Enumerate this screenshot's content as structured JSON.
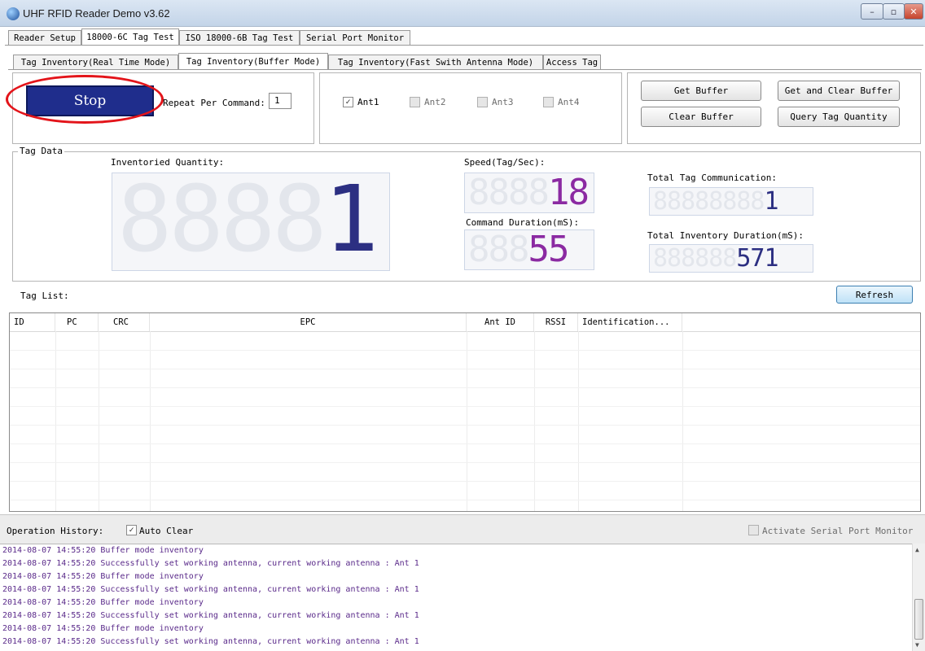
{
  "window": {
    "title": "UHF RFID Reader Demo v3.62",
    "minimize": "–",
    "maximize": "▫",
    "close": "✕"
  },
  "main_tabs": [
    "Reader Setup",
    "18000-6C Tag Test",
    "ISO 18000-6B Tag Test",
    "Serial Port Monitor"
  ],
  "sub_tabs": [
    "Tag Inventory(Real Time Mode)",
    "Tag Inventory(Buffer Mode)",
    "Tag Inventory(Fast Swith Antenna Mode)",
    "Access Tag"
  ],
  "controls": {
    "stop_label": "Stop",
    "repeat_label": "Repeat Per Command:",
    "repeat_value": "1",
    "antennas": [
      {
        "label": "Ant1",
        "checked": true
      },
      {
        "label": "Ant2",
        "checked": false
      },
      {
        "label": "Ant3",
        "checked": false
      },
      {
        "label": "Ant4",
        "checked": false
      }
    ],
    "get_buffer": "Get Buffer",
    "get_clear_buffer": "Get and Clear Buffer",
    "clear_buffer": "Clear Buffer",
    "query_tag_quantity": "Query Tag Quantity"
  },
  "tag_data": {
    "group_label": "Tag Data",
    "inventoried_label": "Inventoried Quantity:",
    "inventoried_value": "1",
    "speed_label": "Speed(Tag/Sec):",
    "speed_value": "18",
    "command_duration_label": "Command Duration(mS):",
    "command_duration_value": "55",
    "total_comm_label": "Total Tag Communication:",
    "total_comm_value": "1",
    "total_duration_label": "Total Inventory Duration(mS):",
    "total_duration_value": "571"
  },
  "tag_list": {
    "label": "Tag List:",
    "refresh": "Refresh",
    "columns": [
      "ID",
      "PC",
      "CRC",
      "EPC",
      "Ant ID",
      "RSSI",
      "Identification..."
    ]
  },
  "history": {
    "label": "Operation History:",
    "auto_clear": "Auto Clear",
    "activate_monitor": "Activate Serial Port Monitor",
    "lines": [
      "2014-08-07 14:55:20 Buffer mode inventory",
      "2014-08-07 14:55:20 Successfully set working antenna, current working antenna : Ant 1",
      "2014-08-07 14:55:20 Buffer mode inventory",
      "2014-08-07 14:55:20 Successfully set working antenna, current working antenna : Ant 1",
      "2014-08-07 14:55:20 Buffer mode inventory",
      "2014-08-07 14:55:20 Successfully set working antenna, current working antenna : Ant 1",
      "2014-08-07 14:55:20 Buffer mode inventory",
      "2014-08-07 14:55:20 Successfully set working antenna, current working antenna : Ant 1"
    ]
  },
  "colors": {
    "stop_button": "#1f2d8c",
    "highlight_ellipse": "#e3141a",
    "digits_blue": "#2c2f82",
    "digits_purple": "#8b2aa2",
    "log_text": "#5a2a8a"
  }
}
